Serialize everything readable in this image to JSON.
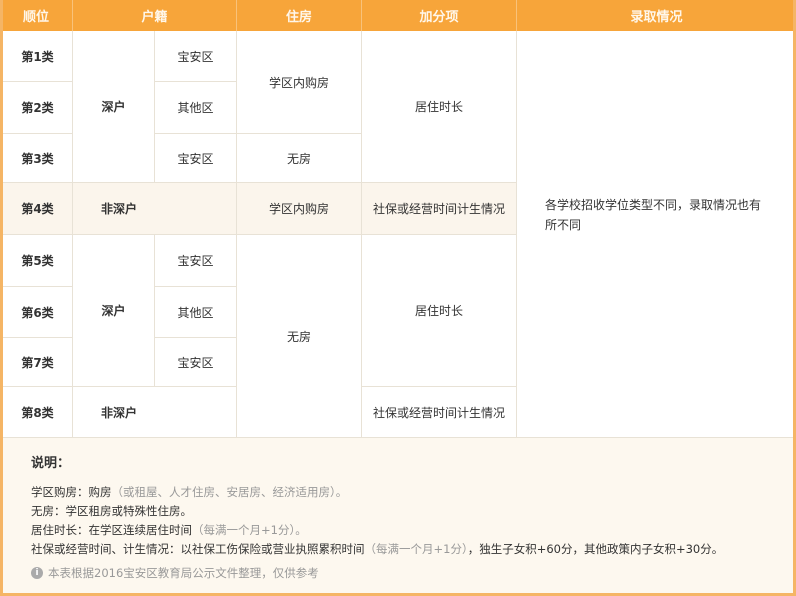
{
  "headers": [
    "顺位",
    "户籍",
    "住房",
    "加分项",
    "录取情况"
  ],
  "rank": [
    "第1类",
    "第2类",
    "第3类",
    "第4类",
    "第5类",
    "第6类",
    "第7类",
    "第8类"
  ],
  "huji": {
    "shen": "深户",
    "feishen": "非深户",
    "baoan": "宝安区",
    "other": "其他区"
  },
  "housing": {
    "buy": "学区内购房",
    "none": "无房"
  },
  "bonus": {
    "live": "居住时长",
    "social": "社保或经营时间计生情况"
  },
  "admission": "各学校招收学位类型不同，录取情况也有所不同",
  "notes": {
    "title": "说明：",
    "l1a": "学区购房：购房",
    "l1b": "（或租屋、人才住房、安居房、经济适用房）。",
    "l2": "无房：学区租房或特殊性住房。",
    "l3a": "居住时长：在学区连续居住时间",
    "l3b": "（每满一个月+1分）。",
    "l4a": "社保或经营时间、计生情况：以社保工伤保险或营业执照累积时间",
    "l4b": "（每满一个月+1分）",
    "l4c": "，独生子女积+60分，其他政策内子女积+30分。",
    "footer": "本表根据2016宝安区教育局公示文件整理，仅供参考"
  }
}
